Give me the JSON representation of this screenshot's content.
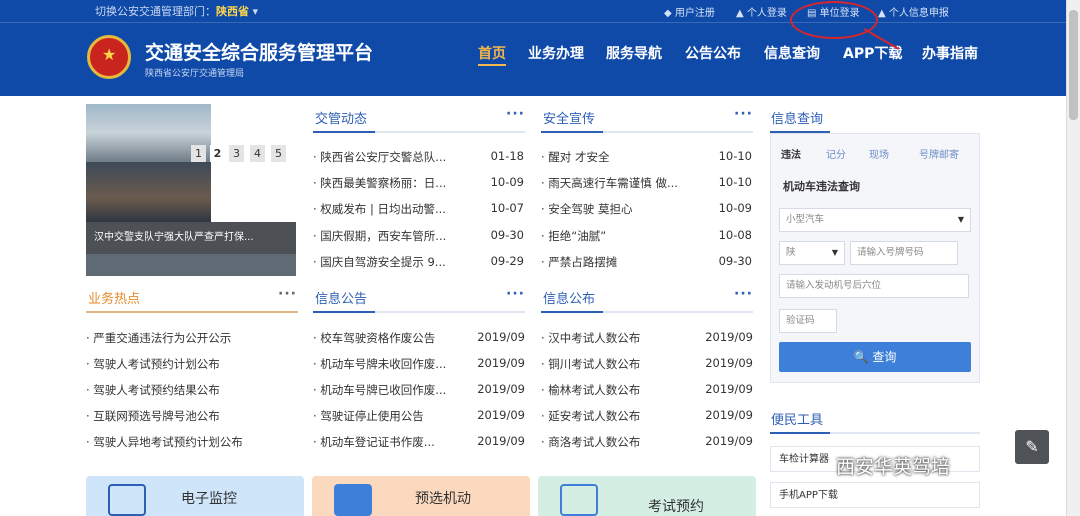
{
  "header": {
    "branch_prefix": "切换公安交通管理部门：",
    "branch_name": "陕西省",
    "branch_caret": "▾",
    "top_links": [
      "◆ 用户注册",
      "▲ 个人登录",
      "▤ 单位登录",
      "▲ 个人信息申报"
    ],
    "site_title": "交通安全综合服务管理平台",
    "site_subtitle": "陕西省公安厅交通管理局",
    "nav": [
      "首页",
      "业务办理",
      "服务导航",
      "公告公布",
      "信息查询",
      "APP下载",
      "办事指南"
    ],
    "active_nav": "首页"
  },
  "slider": {
    "caption": "汉中交警支队宁强大队严查严打保...",
    "pages": [
      "1",
      "2",
      "3",
      "4",
      "5"
    ],
    "active_page": "2"
  },
  "sections": {
    "traffic_news": {
      "title": "交管动态",
      "more": "···",
      "items": [
        {
          "text": "· 陕西省公安厅交警总队...",
          "date": "01-18"
        },
        {
          "text": "· 陕西最美警察杨丽：日...",
          "date": "10-09"
        },
        {
          "text": "· 权威发布 | 日均出动警...",
          "date": "10-07"
        },
        {
          "text": "· 国庆假期，西安车管所...",
          "date": "09-30"
        },
        {
          "text": "· 国庆自驾游安全提示 9...",
          "date": "09-29"
        }
      ]
    },
    "safety": {
      "title": "安全宣传",
      "more": "···",
      "items": [
        {
          "text": "· 醒对 才安全",
          "date": "10-10"
        },
        {
          "text": "· 雨天高速行车需谨慎 做...",
          "date": "10-10"
        },
        {
          "text": "· 安全驾驶 莫担心",
          "date": "10-09"
        },
        {
          "text": "· 拒绝“油腻”",
          "date": "10-08"
        },
        {
          "text": "· 严禁占路摆摊",
          "date": "09-30"
        }
      ]
    },
    "hot": {
      "title": "业务热点",
      "more": "···",
      "items": [
        "· 严重交通违法行为公开公示",
        "· 驾驶人考试预约计划公布",
        "· 驾驶人考试预约结果公布",
        "· 互联网预选号牌号池公布",
        "· 驾驶人异地考试预约计划公布"
      ]
    },
    "notices": {
      "title": "信息公告",
      "more": "···",
      "items": [
        {
          "text": "· 校车驾驶资格作废公告",
          "date": "2019/09"
        },
        {
          "text": "· 机动车号牌未收回作废...",
          "date": "2019/09"
        },
        {
          "text": "· 机动车号牌已收回作废...",
          "date": "2019/09"
        },
        {
          "text": "· 驾驶证停止使用公告",
          "date": "2019/09"
        },
        {
          "text": "· 机动车登记证书作废...",
          "date": "2019/09"
        }
      ]
    },
    "info_release": {
      "title": "信息公布",
      "more": "···",
      "items": [
        {
          "text": "· 汉中考试人数公布",
          "date": "2019/09"
        },
        {
          "text": "· 铜川考试人数公布",
          "date": "2019/09"
        },
        {
          "text": "· 榆林考试人数公布",
          "date": "2019/09"
        },
        {
          "text": "· 延安考试人数公布",
          "date": "2019/09"
        },
        {
          "text": "· 商洛考试人数公布",
          "date": "2019/09"
        }
      ]
    }
  },
  "query": {
    "title": "信息查询",
    "tabs": [
      "违法",
      "记分",
      "现场",
      "号牌邮寄"
    ],
    "active_tab": "违法",
    "form_label": "机动车违法查询",
    "vehicle_type": "小型汽车",
    "province": "陕",
    "plate_placeholder": "请输入号牌号码",
    "vin_placeholder": "请输入发动机号后六位",
    "captcha_placeholder": "验证码",
    "submit": "查询",
    "submit_icon": "🔍"
  },
  "tools": {
    "title": "便民工具",
    "items": [
      "车检计算器",
      "手机APP下载"
    ]
  },
  "cards": [
    {
      "title": "电子监控"
    },
    {
      "title": "预选机动"
    },
    {
      "title": "考试预约"
    }
  ],
  "watermark": "西安华英驾培",
  "colors": {
    "header_bg": "#0f4aa8",
    "accent_blue": "#2d5fb6",
    "accent_orange": "#e98a2b",
    "annotation_red": "#d9252b"
  }
}
